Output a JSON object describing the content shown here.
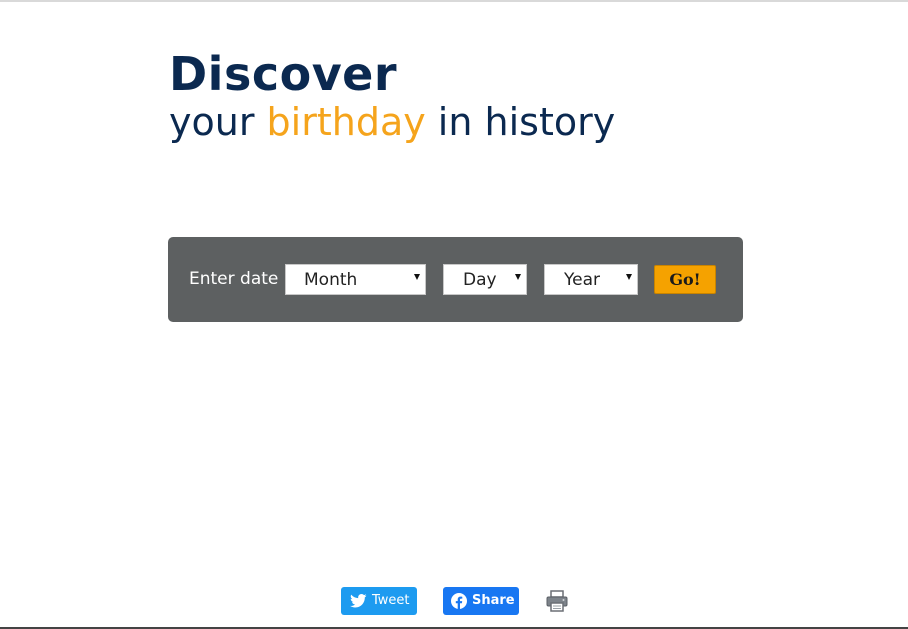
{
  "hero": {
    "title": "Discover",
    "subtitle_before": "your ",
    "subtitle_accent": "birthday",
    "subtitle_after": " in history"
  },
  "date_form": {
    "label": "Enter date",
    "month": {
      "value": "Month"
    },
    "day": {
      "value": "Day"
    },
    "year": {
      "value": "Year"
    },
    "go_label": "Go!"
  },
  "share": {
    "tweet_label": "Tweet",
    "share_label": "Share",
    "print_icon": "printer-icon"
  },
  "colors": {
    "heading_navy": "#0b2950",
    "accent_orange": "#f5a41c",
    "panel_gray": "#5d6061",
    "go_orange": "#f5a200",
    "twitter_blue": "#1d9bf0",
    "facebook_blue": "#1877f2"
  }
}
